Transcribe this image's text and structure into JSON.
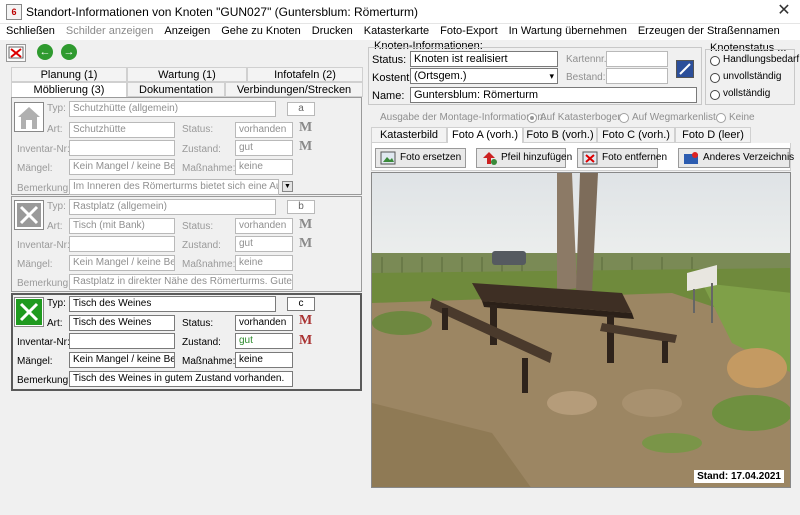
{
  "window": {
    "icon_text": "6",
    "title": "Standort-Informationen von Knoten \"GUN027\" (Guntersblum: Römerturm)",
    "close_glyph": "✕"
  },
  "menu": [
    {
      "label": "Schließen",
      "enabled": true
    },
    {
      "label": "Schilder anzeigen",
      "enabled": false
    },
    {
      "label": "Anzeigen",
      "enabled": true
    },
    {
      "label": "Gehe zu Knoten",
      "enabled": true
    },
    {
      "label": "Drucken",
      "enabled": true
    },
    {
      "label": "Katasterkarte",
      "enabled": true
    },
    {
      "label": "Foto-Export",
      "enabled": true
    },
    {
      "label": "In Wartung übernehmen",
      "enabled": true
    },
    {
      "label": "Erzeugen der Straßennamen",
      "enabled": true
    }
  ],
  "left_tabs_row1": [
    "Planung (1)",
    "Wartung (1)",
    "Infotafeln (2)"
  ],
  "left_tabs_row2": [
    "Möblierung (3)",
    "Dokumentation",
    "Verbindungen/Strecken"
  ],
  "labels": {
    "typ": "Typ:",
    "art": "Art:",
    "status": "Status:",
    "inventar": "Inventar-Nr:",
    "zustand": "Zustand:",
    "mangel": "Mängel:",
    "massnahme": "Maßnahme:",
    "bemerkung": "Bemerkung:"
  },
  "furniture": [
    {
      "code": "a",
      "typ": "Schutzhütte (allgemein)",
      "art": "Schutzhütte",
      "status": "vorhanden",
      "inventar": "",
      "zustand": "gut",
      "mangel": "Kein Mangel / keine Bes...",
      "massnahme": "keine",
      "bemerkung": "Im Inneren des Römerturms bietet sich eine Aufenth..."
    },
    {
      "code": "b",
      "typ": "Rastplatz (allgemein)",
      "art": "Tisch (mit Bank)",
      "status": "vorhanden",
      "inventar": "",
      "zustand": "gut",
      "mangel": "Kein Mangel / keine Bes...",
      "massnahme": "keine",
      "bemerkung": "Rastplatz in direkter Nähe des Römerturms. Guter Zust..."
    },
    {
      "code": "c",
      "typ": "Tisch des Weines",
      "art": "Tisch des Weines",
      "status": "vorhanden",
      "inventar": "",
      "zustand": "gut",
      "mangel": "Kein Mangel / keine Bes...",
      "massnahme": "keine",
      "bemerkung": "Tisch des Weines in gutem Zustand vorhanden."
    }
  ],
  "knoten": {
    "legend": "Knoten-Informationen:",
    "status_label": "Status:",
    "status_value": "Knoten ist realisiert",
    "kostentr_label": "Kostentr.:",
    "kostentr_value": "(Ortsgem.)",
    "name_label": "Name:",
    "name_value": "Guntersblum: Römerturm",
    "kartennr_label": "Kartennr.:",
    "kartennr_value": "",
    "bestand_label": "Bestand:",
    "bestand_value": ""
  },
  "knotenstatus": {
    "legend": "Knotenstatus ...",
    "options": [
      "Handlungsbedarf",
      "unvollständig",
      "vollständig"
    ]
  },
  "montage": {
    "label": "Ausgabe der Montage-Informationen:",
    "options": [
      "Auf Katasterbogen",
      "Auf Wegmarkenliste",
      "Keine"
    ],
    "selected": 0
  },
  "photo_tabs": [
    "Katasterbild",
    "Foto A (vorh.)",
    "Foto B (vorh.)",
    "Foto C (vorh.)",
    "Foto D (leer)"
  ],
  "photo_active_tab": 1,
  "photo_buttons": [
    "Foto ersetzen",
    "Pfeil hinzufügen",
    "Foto entfernen",
    "Anderes Verzeichnis"
  ],
  "photo_stamp": "Stand: 17.04.2021",
  "colors": {
    "accent_green": "#2f9a2f",
    "status_good": "#2a8a2a"
  },
  "icons": {
    "toolbar": [
      "delete-icon",
      "back-arrow-icon",
      "forward-arrow-icon"
    ],
    "group_symbols": [
      "shelter-house-icon",
      "cross-grey-icon",
      "cross-green-icon"
    ]
  }
}
